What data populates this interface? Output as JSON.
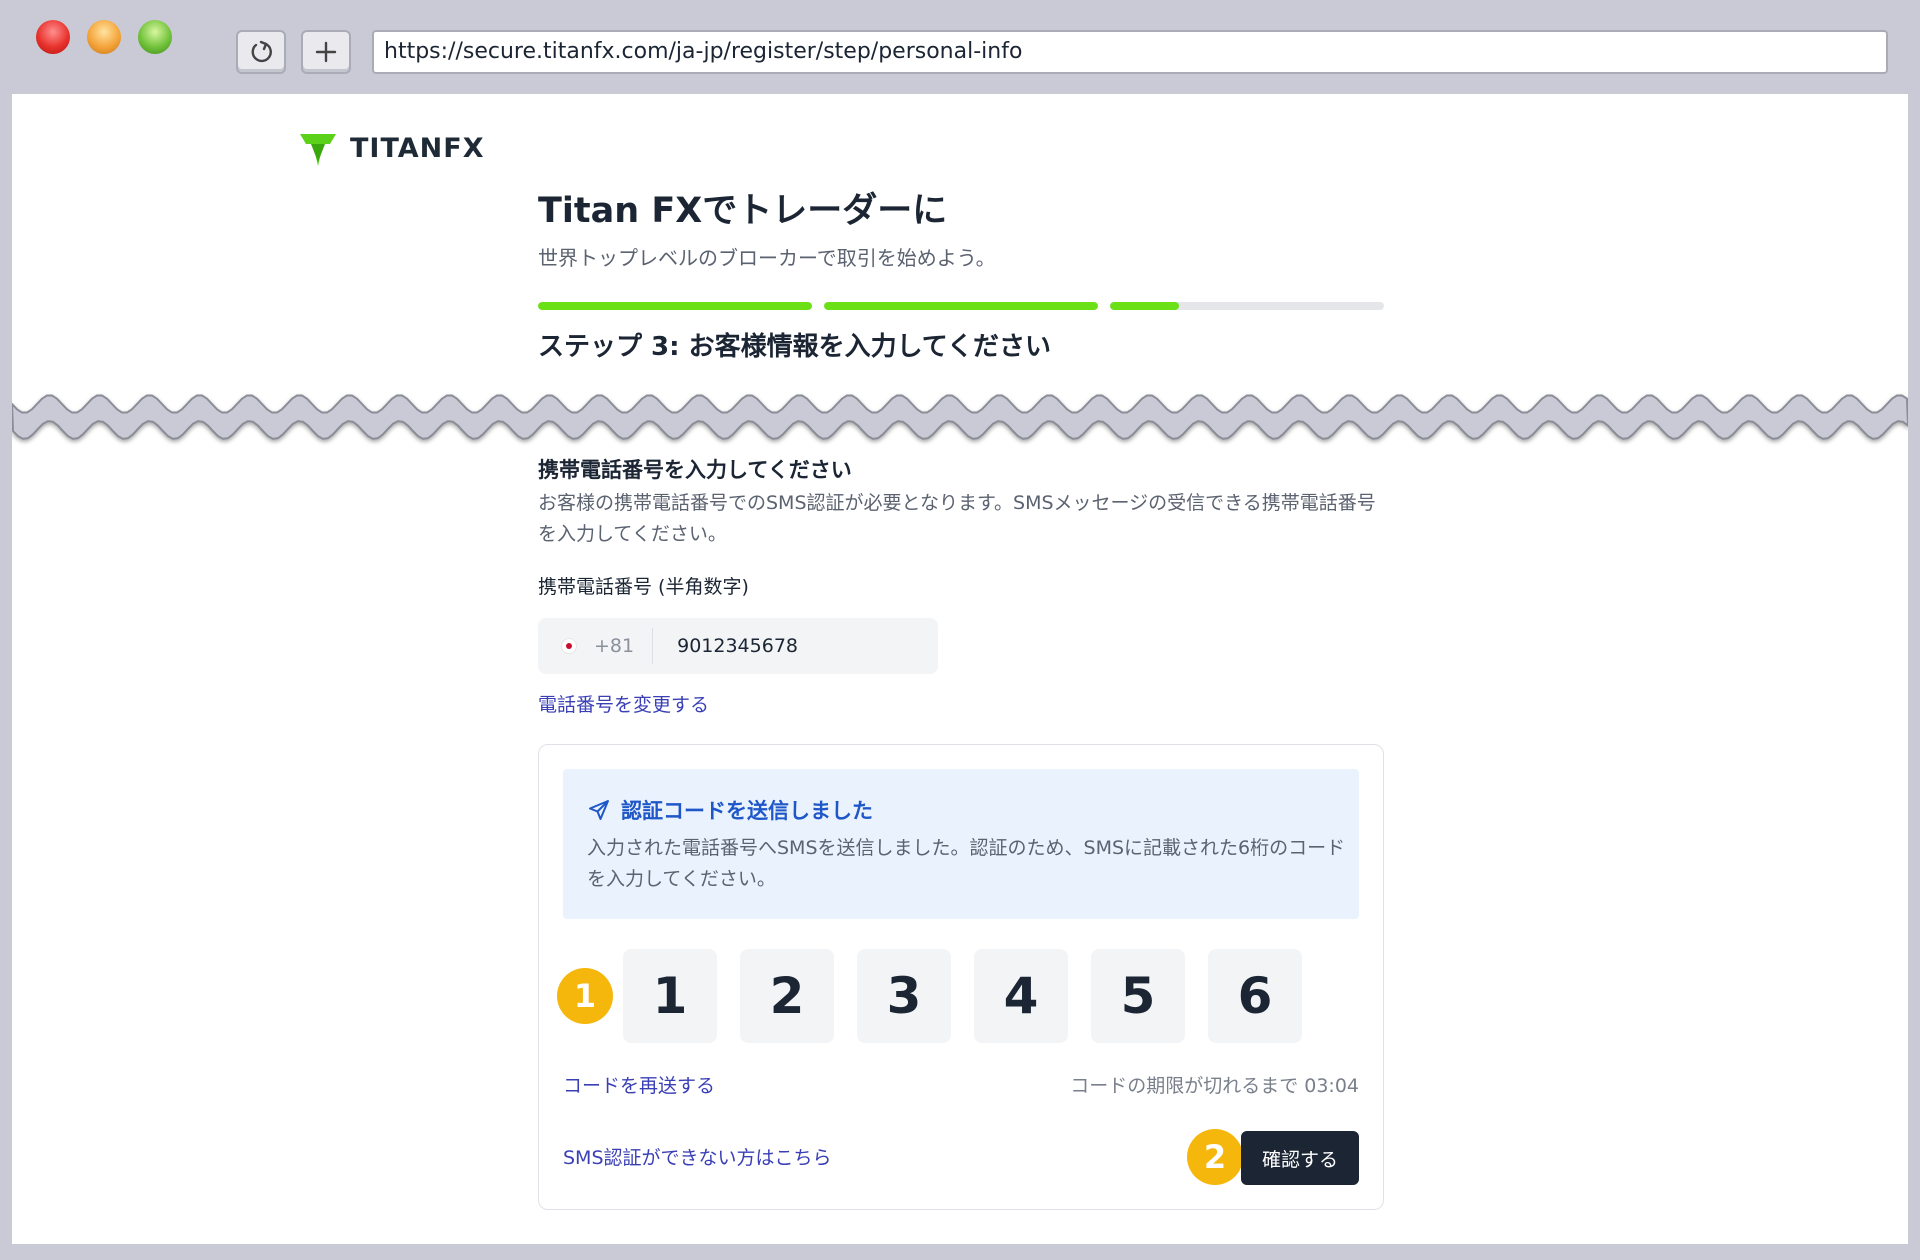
{
  "browser": {
    "url": "https://secure.titanfx.com/ja-jp/register/step/personal-info",
    "reload_icon": "reload-icon",
    "new_tab_icon": "plus-icon"
  },
  "brand": {
    "logo_text": "TITANFX",
    "accent_color": "#6be016"
  },
  "header": {
    "title": "Titan FXでトレーダーに",
    "subtitle": "世界トップレベルのブローカーで取引を始めよう。"
  },
  "progress": {
    "segments": [
      1,
      1,
      0.25
    ]
  },
  "step": {
    "title": "ステップ 3: お客様情報を入力してください"
  },
  "phone_section": {
    "title": "携帯電話番号を入力してください",
    "description": "お客様の携帯電話番号でのSMS認証が必要となります。SMSメッセージの受信できる携帯電話番号を入力してください。",
    "field_label": "携帯電話番号 (半角数字)",
    "country_code": "+81",
    "number": "9012345678",
    "change_link": "電話番号を変更する"
  },
  "verification": {
    "notice_title": "認証コードを送信しました",
    "notice_body": "入力された電話番号へSMSを送信しました。認証のため、SMSに記載された6桁のコードを入力してください。",
    "digits": [
      "1",
      "2",
      "3",
      "4",
      "5",
      "6"
    ],
    "resend_link": "コードを再送する",
    "timer_text": "コードの期限が切れるまで 03:04",
    "help_link": "SMS認証ができない方はこちら",
    "confirm_button": "確認する"
  },
  "annotations": {
    "badge1": "1",
    "badge2": "2"
  }
}
